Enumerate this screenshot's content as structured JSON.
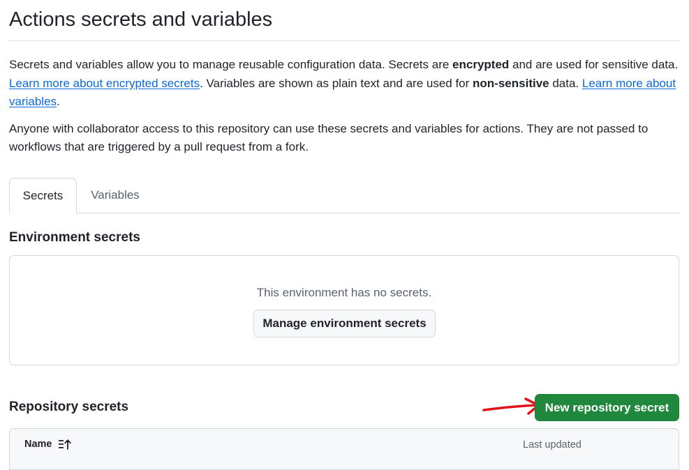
{
  "page": {
    "title": "Actions secrets and variables"
  },
  "description": {
    "p1_part1": "Secrets and variables allow you to manage reusable configuration data. Secrets are ",
    "p1_bold1": "encrypted",
    "p1_part2": " and are used for sensitive data. ",
    "p1_link1": "Learn more about encrypted secrets",
    "p1_part3": ". Variables are shown as plain text and are used for ",
    "p1_bold2": "non-sensitive",
    "p1_part4": " data. ",
    "p1_link2": "Learn more about variables",
    "p1_part5": ".",
    "p2": "Anyone with collaborator access to this repository can use these secrets and variables for actions. They are not passed to workflows that are triggered by a pull request from a fork."
  },
  "tabs": [
    {
      "label": "Secrets",
      "active": true
    },
    {
      "label": "Variables",
      "active": false
    }
  ],
  "environment_secrets": {
    "heading": "Environment secrets",
    "empty_text": "This environment has no secrets.",
    "manage_button": "Manage environment secrets"
  },
  "repository_secrets": {
    "heading": "Repository secrets",
    "new_button": "New repository secret",
    "columns": {
      "name": "Name",
      "last_updated": "Last updated"
    },
    "sort_icon": "sort-ascending-icon"
  },
  "colors": {
    "accent_link": "#0969da",
    "primary_button": "#1f883d",
    "annotation_arrow": "#e0121a"
  }
}
